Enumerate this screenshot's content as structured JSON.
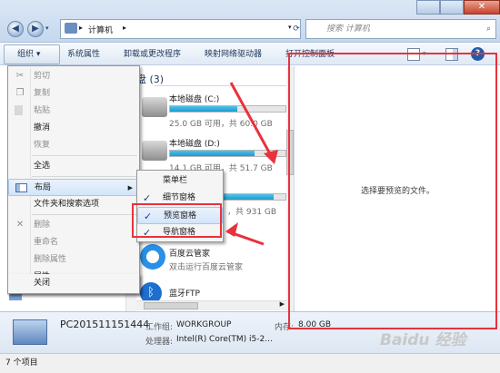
{
  "address": {
    "crumb": "计算机",
    "search_placeholder": "搜索 计算机"
  },
  "toolbar": {
    "organize": "组织 ▾",
    "items": [
      "系统属性",
      "卸载或更改程序",
      "映射网络驱动器",
      "打开控制面板"
    ]
  },
  "organize_menu": {
    "items": [
      {
        "label": "剪切",
        "enabled": false,
        "icon": "scissors-icon",
        "glyph": "✂"
      },
      {
        "label": "复制",
        "enabled": false,
        "icon": "copy-icon",
        "glyph": "❐"
      },
      {
        "label": "粘贴",
        "enabled": false,
        "icon": "paste-icon",
        "glyph": "📋"
      },
      {
        "label": "撤消",
        "enabled": true
      },
      {
        "label": "恢复",
        "enabled": false
      },
      {
        "label": "全选",
        "enabled": true
      },
      {
        "label": "布局",
        "enabled": true,
        "icon": "layout-icon",
        "submenu": true
      },
      {
        "label": "文件夹和搜索选项",
        "enabled": true
      },
      {
        "label": "删除",
        "enabled": false,
        "icon": "delete-icon",
        "glyph": "✕"
      },
      {
        "label": "重命名",
        "enabled": false
      },
      {
        "label": "删除属性",
        "enabled": false
      },
      {
        "label": "属性",
        "enabled": true
      },
      {
        "label": "关闭",
        "enabled": true
      }
    ]
  },
  "layout_submenu": {
    "items": [
      {
        "label": "菜单栏",
        "checked": false
      },
      {
        "label": "细节窗格",
        "checked": true
      },
      {
        "label": "预览窗格",
        "checked": true
      },
      {
        "label": "导航窗格",
        "checked": true
      }
    ]
  },
  "content": {
    "section_header": "盘 (3)",
    "drives": [
      {
        "name": "本地磁盘 (C:)",
        "detail": "25.0 GB 可用，共 60.0 GB",
        "fill": 0.58
      },
      {
        "name": "本地磁盘 (D:)",
        "detail": "14.1 GB 可用，共 51.7 GB",
        "fill": 0.73
      },
      {
        "name": "",
        "detail": "，共 931 GB",
        "fill": 0.9
      }
    ],
    "apps": [
      {
        "name": "百度云管家",
        "detail": "双击运行百度云管家",
        "icon": "baidu-cloud-icon"
      },
      {
        "name": "蓝牙FTP",
        "detail": "",
        "icon": "bluetooth-icon"
      }
    ]
  },
  "preview": {
    "message": "选择要预览的文件。"
  },
  "details": {
    "computer_name": "PC201511151444",
    "workgroup_label": "工作组:",
    "workgroup": "WORKGROUP",
    "memory_label": "内存:",
    "memory": "8.00 GB",
    "cpu_label": "处理器:",
    "cpu": "Intel(R) Core(TM) i5-2..."
  },
  "statusbar": {
    "count": "7 个项目"
  },
  "watermark": "Baidu 经验",
  "colors": {
    "annotation_red": "#e8323c",
    "drive_fill": "#1e9ad0"
  }
}
